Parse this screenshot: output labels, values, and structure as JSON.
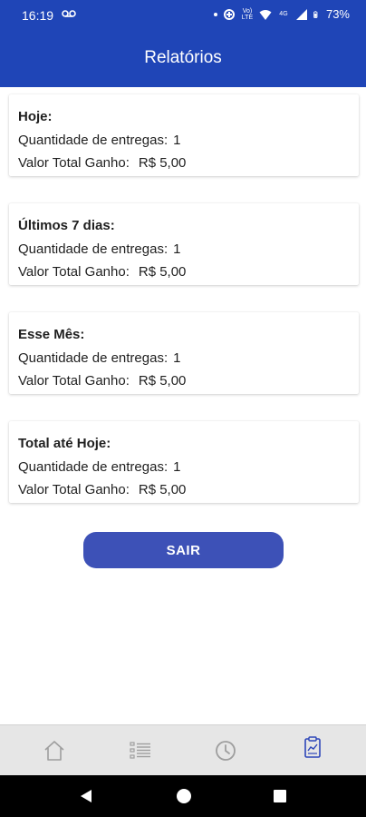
{
  "status_bar": {
    "time": "16:19",
    "volte": "Vo) LTE",
    "network": "4G",
    "battery": "73%"
  },
  "app_bar": {
    "title": "Relatórios"
  },
  "cards": [
    {
      "title": "Hoje:",
      "deliveries_label": "Quantidade de entregas:",
      "deliveries_value": "1",
      "total_label": "Valor Total Ganho:",
      "total_value": "R$ 5,00"
    },
    {
      "title": "Últimos 7 dias:",
      "deliveries_label": "Quantidade de entregas:",
      "deliveries_value": "1",
      "total_label": "Valor Total Ganho:",
      "total_value": "R$ 5,00"
    },
    {
      "title": "Esse Mês:",
      "deliveries_label": "Quantidade de entregas:",
      "deliveries_value": "1",
      "total_label": "Valor Total Ganho:",
      "total_value": "R$ 5,00"
    },
    {
      "title": "Total até Hoje:",
      "deliveries_label": "Quantidade de entregas:",
      "deliveries_value": "1",
      "total_label": "Valor Total Ganho:",
      "total_value": "R$ 5,00"
    }
  ],
  "sair_button": {
    "label": "SAIR"
  },
  "bottom_nav": {
    "items": [
      {
        "icon": "home-icon",
        "active": false
      },
      {
        "icon": "list-icon",
        "active": false
      },
      {
        "icon": "clock-icon",
        "active": false
      },
      {
        "icon": "clipboard-icon",
        "active": true
      }
    ]
  },
  "colors": {
    "primary": "#1f45b7",
    "button": "#3d51b7",
    "nav_active": "#2d46b9",
    "nav_inactive": "#9e9e9e"
  }
}
